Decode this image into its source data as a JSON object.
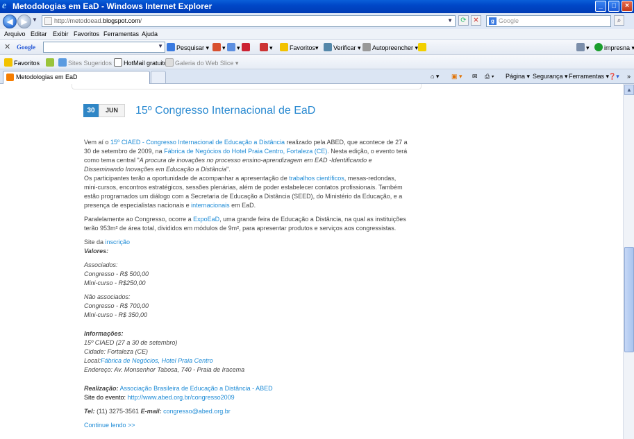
{
  "window": {
    "title": "Metodologias em EaD - Windows Internet Explorer",
    "min": "_",
    "max": "□",
    "close": "×"
  },
  "address": {
    "url_prefix": "http://metodoead.",
    "url_domain": "blogspot.com",
    "url_suffix": "/",
    "search_placeholder": "Google"
  },
  "menu": [
    "Arquivo",
    "Editar",
    "Exibir",
    "Favoritos",
    "Ferramentas",
    "Ajuda"
  ],
  "google_toolbar": {
    "logo": "Google",
    "pesquisar": "Pesquisar",
    "favoritos": "Favoritos",
    "verificar": "Verificar",
    "autopreencher": "Autopreencher",
    "impresna": "impresna"
  },
  "favbar": {
    "favoritos": "Favoritos",
    "sites": "Sites Sugeridos",
    "hotmail": "HotMail gratuito",
    "galeria": "Galeria do Web Slice"
  },
  "tab": {
    "label": "Metodologias em EaD"
  },
  "commandbar": {
    "pagina": "Página",
    "seguranca": "Segurança",
    "ferramentas": "Ferramentas"
  },
  "post": {
    "day": "30",
    "month": "JUN",
    "title": "15º Congresso Internacional de EaD",
    "p1_a": "Vem aí o ",
    "p1_link1": "15º CIAED - Congresso Internacional de Educação a Distância",
    "p1_b": " realizado pela ABED, que acontece de 27 a 30 de setembro de 2009, na ",
    "p1_link2": "Fábrica de Negócios do Hotel Praia Centro, Fortaleza (CE)",
    "p1_c": ". Nesta edição, o evento terá como tema central \"",
    "p1_em": "A procura de inovações no processo ensino-aprendizagem em EAD -Identificando e Disseminando Inovações em Educação a Distância",
    "p1_d": "\".",
    "p2_a": "Os participantes terão a oportunidade de acompanhar a apresentação de ",
    "p2_link1": "trabalhos científicos",
    "p2_b": ", mesas-redondas, mini-cursos, encontros estratégicos, sessões plenárias, além de poder estabelecer contatos profissionais. Também estão programados um diálogo com a Secretaria de Educação a Distância (SEED), do Ministério da Educação, e a presença de especialistas nacionais e ",
    "p2_link2": "internacionais",
    "p2_c": " em EaD.",
    "p3_a": "Paralelamente ao Congresso, ocorre a ",
    "p3_link": "ExpoEaD",
    "p3_b": ", uma grande feira de Educação a Distância, na qual as instituições terão 953m² de área total, divididos em módulos de 9m², para apresentar produtos e serviços aos congressistas.",
    "site_a": "Site da ",
    "site_link": "inscrição",
    "valores": "Valores:",
    "assoc_h": "Associados:",
    "assoc_1": "Congresso  - R$ 500,00",
    "assoc_2": "Mini-curso - R$250,00",
    "nassoc_h": "Não associados:",
    "nassoc_1": "Congresso - R$ 700,00",
    "nassoc_2": "Mini-curso - R$ 350,00",
    "info_h": "Informações:",
    "info_1": "15º CIAED (27 a 30 de setembro)",
    "info_2": "Cidade: Fortaleza (CE)",
    "info_3a": "Local:",
    "info_3b": "Fábrica de Negócios, Hotel Praia Centro",
    "info_4": "Endereço: Av. Monsenhor Tabosa, 740 - Praia de Iracema",
    "real_label": "Realização:",
    "real_link": "Associação Brasileira de Educação a Distância - ABED",
    "site_evento_label": "Site do evento: ",
    "site_evento_link": "http://www.abed.org.br/congresso2009",
    "tel_label": "Tel:",
    "tel_value": " (11) 3275-3561 ",
    "email_label": "E-mail:",
    "email_value": "congresso@abed.org.br",
    "continue": "Continue lendo >>"
  }
}
